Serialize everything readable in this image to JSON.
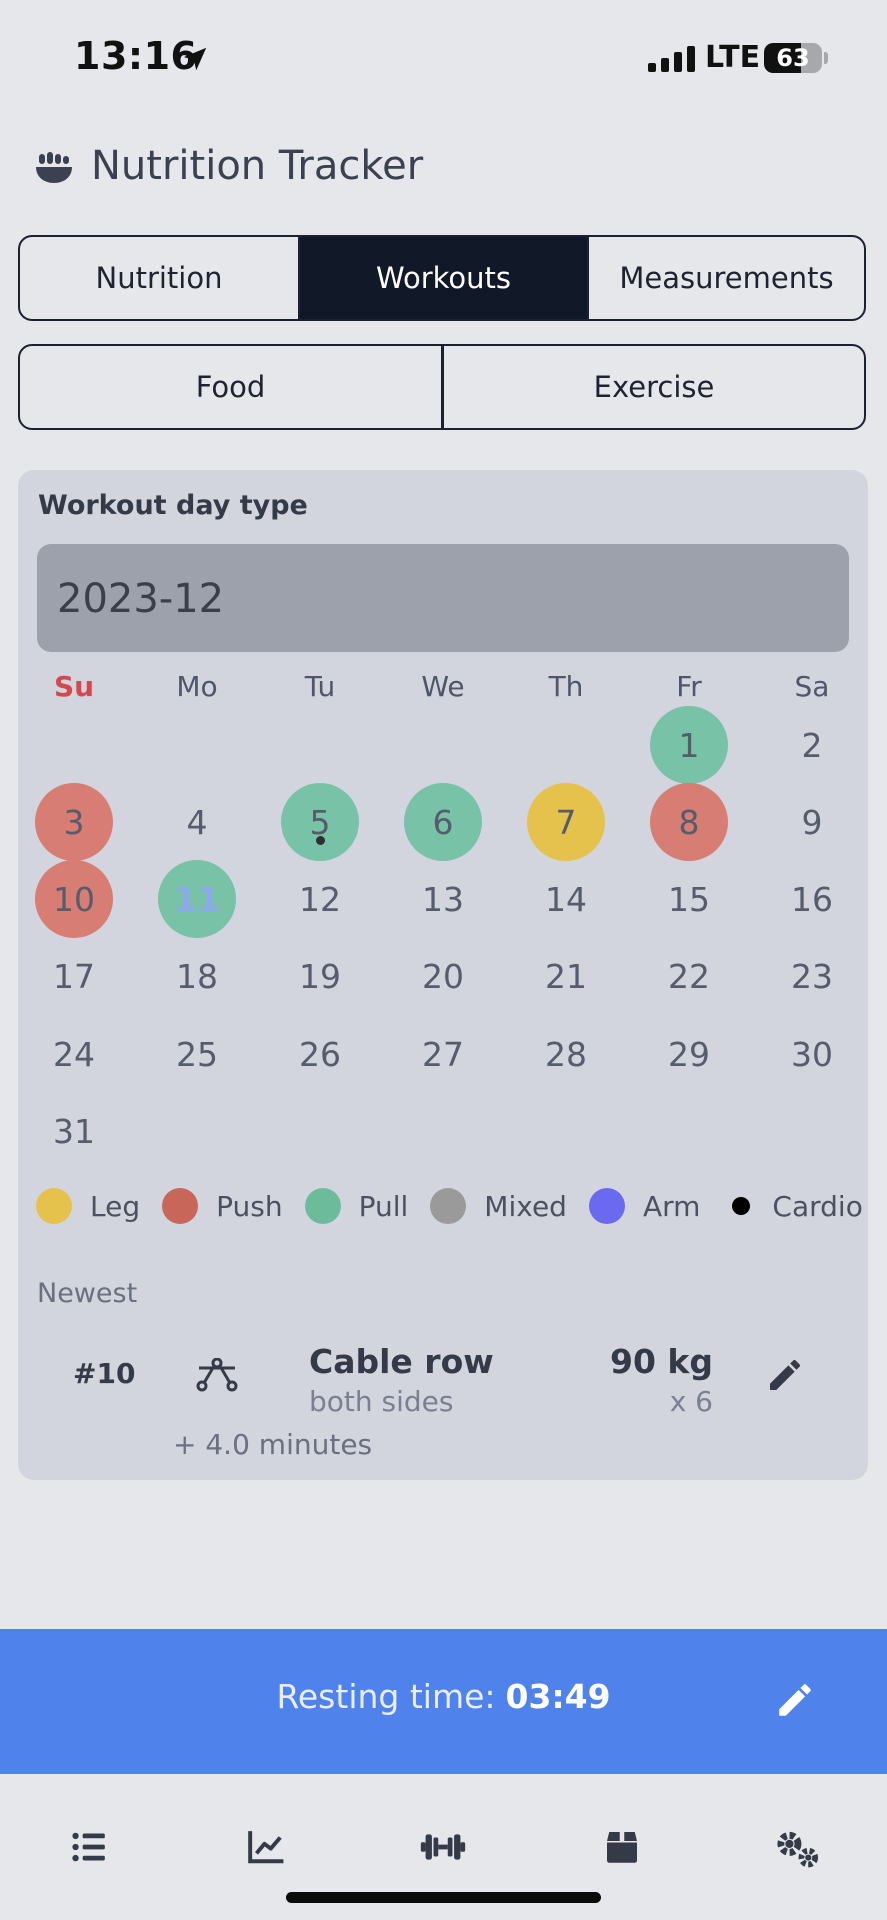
{
  "status_bar": {
    "time": "13:16",
    "network": "LTE",
    "battery": 63
  },
  "header": {
    "title": "Nutrition Tracker",
    "icon": "bowl-food-icon"
  },
  "main_tabs": [
    {
      "label": "Nutrition",
      "active": false
    },
    {
      "label": "Workouts",
      "active": true
    },
    {
      "label": "Measurements",
      "active": false
    }
  ],
  "sub_tabs": [
    {
      "label": "Food",
      "active": false
    },
    {
      "label": "Exercise",
      "active": false
    }
  ],
  "card": {
    "title": "Workout day type",
    "month": "2023-12",
    "weekdays": [
      "Su",
      "Mo",
      "Tu",
      "We",
      "Th",
      "Fr",
      "Sa"
    ],
    "day_types": {
      "1": "pull",
      "3": "push",
      "5": "pull",
      "6": "pull",
      "7": "leg",
      "8": "push",
      "10": "push",
      "11": "pull"
    },
    "cardio_days": [
      5
    ],
    "today": 11,
    "legend": [
      {
        "label": "Leg",
        "color": "#e4c24b"
      },
      {
        "label": "Push",
        "color": "#c8665a"
      },
      {
        "label": "Pull",
        "color": "#6cbc9c"
      },
      {
        "label": "Mixed",
        "color": "#9a9a9a"
      },
      {
        "label": "Arm",
        "color": "#6a6af0"
      },
      {
        "label": "Cardio",
        "color": "#000000",
        "small": true
      }
    ],
    "newest_label": "Newest",
    "newest": {
      "number": "#10",
      "name": "Cable row",
      "detail": "both sides",
      "weight": "90 kg",
      "reps": "x 6",
      "extra": "+ 4.0 minutes",
      "icon": "cable-row-icon"
    }
  },
  "resting": {
    "label": "Resting time:",
    "value": "03:49"
  },
  "bottom_nav": [
    {
      "icon": "list-icon"
    },
    {
      "icon": "chart-line-icon"
    },
    {
      "icon": "dumbbell-icon"
    },
    {
      "icon": "archive-box-icon"
    },
    {
      "icon": "gears-icon"
    }
  ]
}
